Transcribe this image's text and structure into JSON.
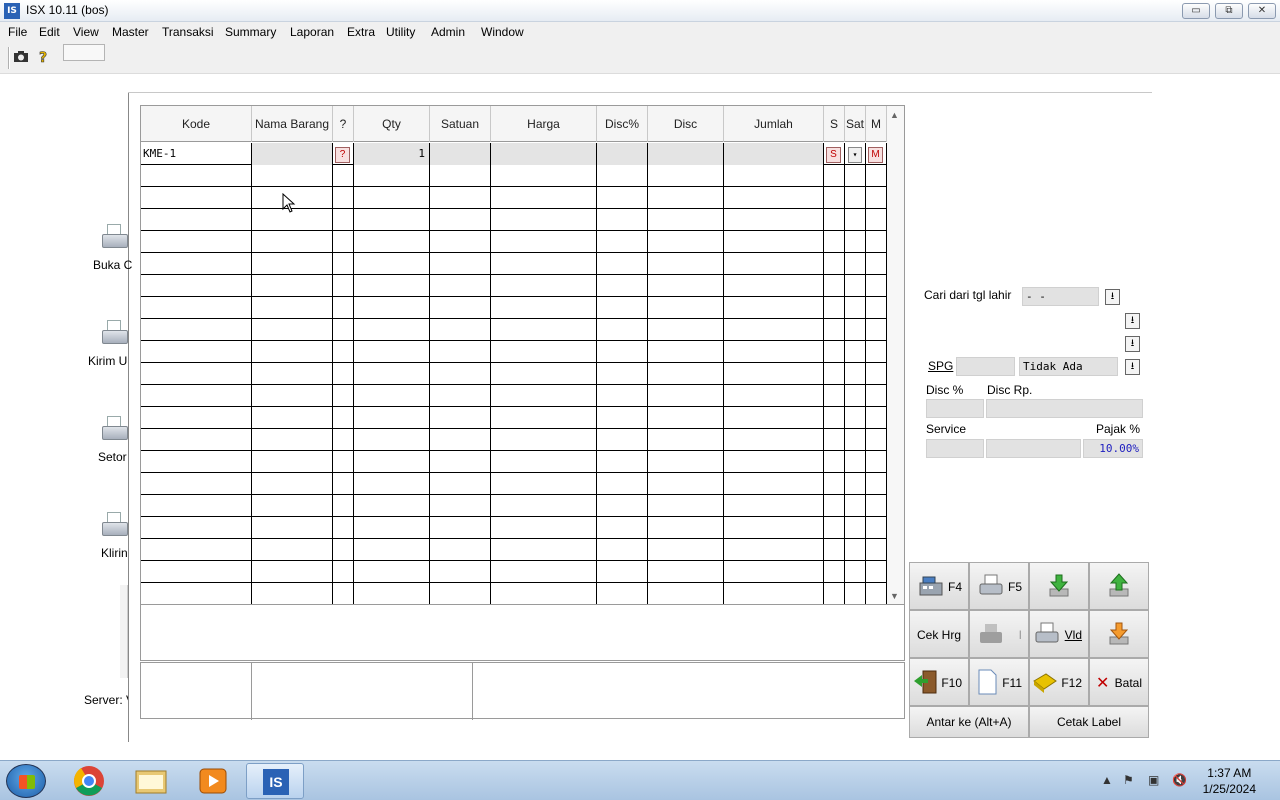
{
  "window": {
    "title": "ISX 10.11 (bos)",
    "logo": "IS",
    "min": "▭",
    "restore": "⧉",
    "close": "✕"
  },
  "menu": [
    "File",
    "Edit",
    "View",
    "Master",
    "Transaksi",
    "Summary",
    "Laporan",
    "Extra",
    "Utility",
    "Admin",
    "Window"
  ],
  "toolbar": {
    "icons": [
      "camera-icon",
      "help-icon"
    ]
  },
  "left_shortcuts": [
    {
      "label": "Buka C",
      "icon": "printer-icon"
    },
    {
      "label": "Kirim U",
      "icon": "printer-icon"
    },
    {
      "label": "Setor",
      "icon": "printer-icon"
    },
    {
      "label": "Kliring",
      "icon": "printer-icon"
    }
  ],
  "server_label": "Server: V",
  "grid": {
    "columns": [
      "Kode",
      "Nama Barang",
      "?",
      "Qty",
      "Satuan",
      "Harga",
      "Disc%",
      "Disc",
      "Jumlah",
      "S",
      "Sat",
      "M"
    ],
    "first_row": {
      "kode": "KME-1",
      "q_btn": "?",
      "qty": "1",
      "s_btn": "S",
      "sat_btn": "▾",
      "m_btn": "M"
    },
    "empty_rows": 20
  },
  "right_form": {
    "cari_label": "Cari dari tgl lahir",
    "cari_value": " -  -",
    "spg_label": "SPG",
    "spg_value": "Tidak Ada",
    "disc_pct_label": "Disc %",
    "disc_rp_label": "Disc Rp.",
    "service_label": "Service",
    "pajak_label": "Pajak %",
    "pajak_value": "10.00%"
  },
  "buttons": {
    "f4": "F4",
    "f5": "F5",
    "cek_hrg": "Cek Hrg",
    "vld": "Vld",
    "f10": "F10",
    "f11": "F11",
    "f12": "F12",
    "batal": "Batal",
    "antar": "Antar ke (Alt+A)",
    "cetak_label": "Cetak Label"
  },
  "taskbar": {
    "time": "1:37 AM",
    "date": "1/25/2024",
    "apps": [
      "chrome",
      "explorer",
      "media-player",
      "isx"
    ]
  }
}
